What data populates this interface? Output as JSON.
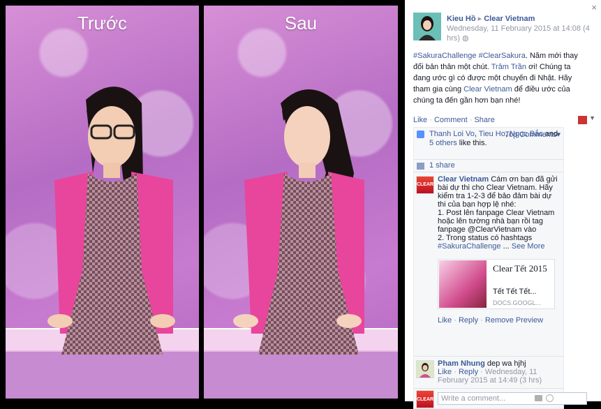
{
  "photo": {
    "before_label": "Trước",
    "after_label": "Sau"
  },
  "post": {
    "author": "Kieu Hồ",
    "page": "Clear Vietnam",
    "timestamp": "Wednesday, 11 February 2015 at 14:08 (4 hrs)",
    "hashtag1": "#SakuraChallenge",
    "hashtag2": "#ClearSakura",
    "text1": ". Năm mới thay đổi bản thân một chút. ",
    "mention": "Trâm Trần",
    "text2": " ơi! Chúng ta đang ước gì có được một chuyến đi Nhật. Hãy tham gia cùng ",
    "page_link": "Clear Vietnam",
    "text3": " để điều ước của chúng ta đến gần hơn bạn nhé!"
  },
  "actions": {
    "like": "Like",
    "comment": "Comment",
    "share": "Share",
    "sep": "·"
  },
  "likes": {
    "name1": "Thanh Loi Vo",
    "name2": "Tieu Ho",
    "name3": "Ngọc Bắc",
    "others": "5 others",
    "suffix": " like this.",
    "top_comments": "Top Comments"
  },
  "shares": {
    "label": "1 share"
  },
  "comment1": {
    "author": "Clear Vietnam",
    "text": "Cám ơn bạn đã gửi bài dự thi cho Clear Vietnam. Hãy kiểm tra 1-2-3 để bảo đảm bài dự thi của bạn hợp lệ nhé:",
    "line1": "1. Post lên fanpage Clear Vietnam hoặc lên tường nhà bạn rồi tag fanpage @ClearVietnam vào",
    "line2": "2. Trong status có hashtags",
    "hashtag": "#SakuraChallenge",
    "ellipsis": " ... ",
    "see_more": "See More",
    "attach_title": "Clear Tết 2015",
    "attach_sub": "Tết Tết Tết...",
    "attach_domain": "DOCS.GOOGL...",
    "like": "Like",
    "reply": "Reply",
    "remove_preview": "Remove Preview",
    "logo_text": "CLEAR"
  },
  "comment2": {
    "author": "Pham Nhung",
    "text": " dep wa hjhj",
    "like": "Like",
    "reply": "Reply",
    "timestamp": "Wednesday, 11 February 2015 at 14:49 (3 hrs)"
  },
  "input": {
    "placeholder": "Write a comment..."
  },
  "close": "×"
}
